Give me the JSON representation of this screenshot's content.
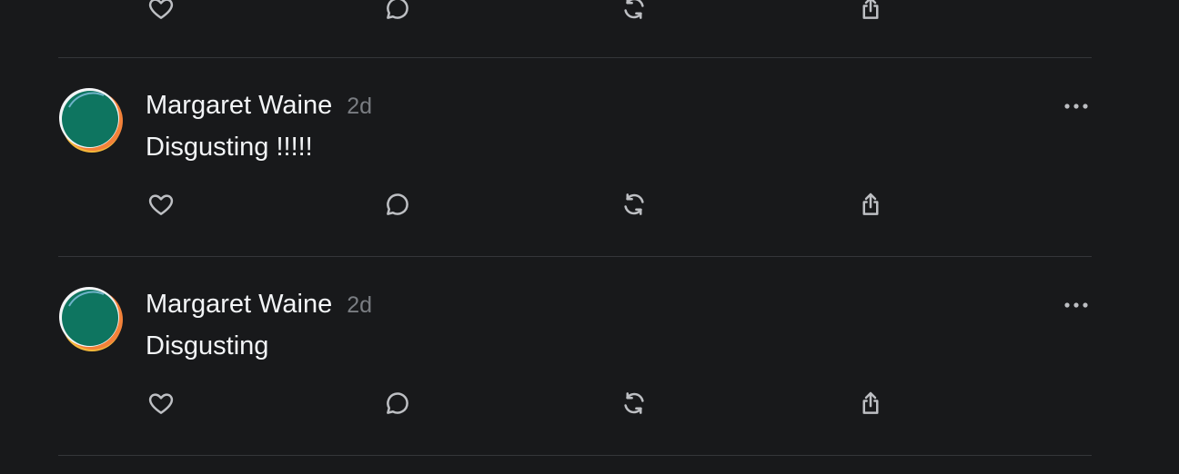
{
  "feed": {
    "posts": [
      {
        "author": "Margaret Waine",
        "time": "2d",
        "text": "Disgusting !!!!!"
      },
      {
        "author": "Margaret Waine",
        "time": "2d",
        "text": "Disgusting"
      }
    ]
  },
  "icons": {
    "like": "heart-icon",
    "reply": "comment-bubble-icon",
    "repost": "repost-arrows-icon",
    "share": "share-upload-icon",
    "more": "more-horizontal-icon"
  },
  "colors": {
    "background": "#18191b",
    "primary_text": "#f3f5f7",
    "secondary_text": "#7a7d82",
    "icon": "#bdbfc3",
    "divider": "#34363a",
    "avatar_green": "#0e7560",
    "avatar_orange": "#f3823a",
    "avatar_yellow": "#f4b83a"
  }
}
